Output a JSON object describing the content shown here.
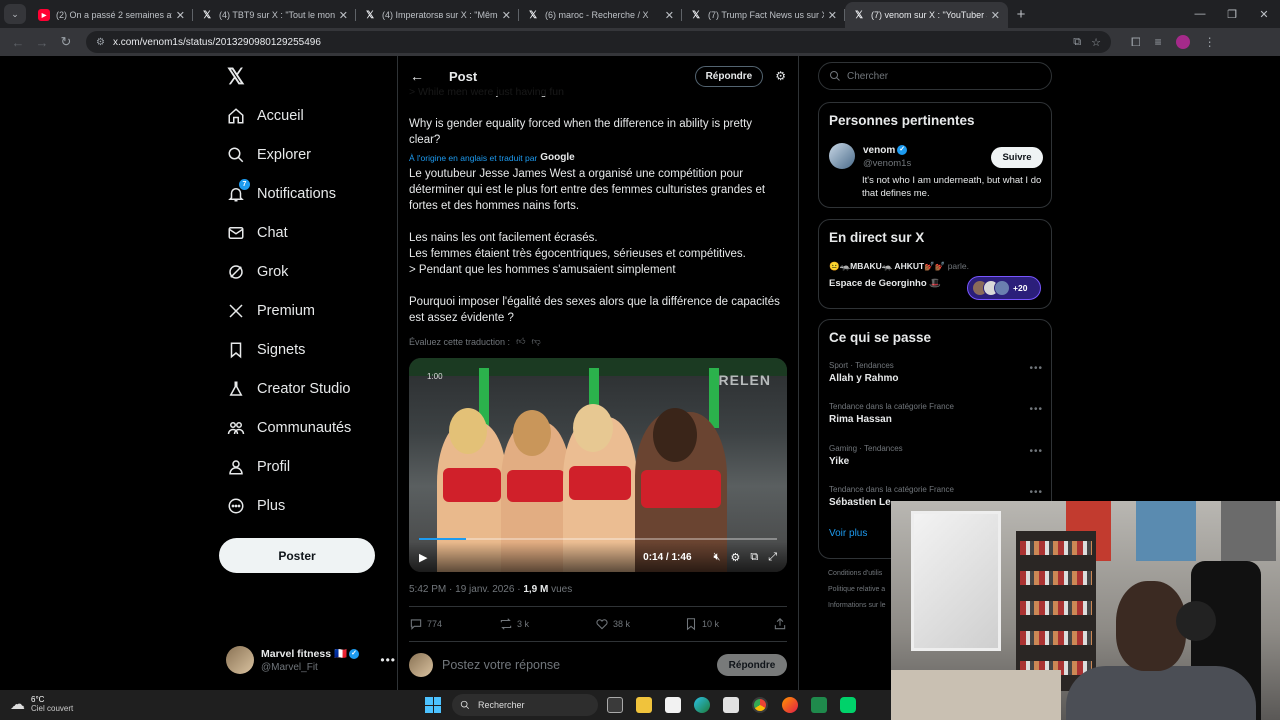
{
  "browser": {
    "tabs": [
      {
        "title": "(2) On a passé 2 semaines avec",
        "icon": "youtube-icon",
        "active": false
      },
      {
        "title": "(4) TBT9 sur X : \"Tout le monde",
        "icon": "x-icon",
        "active": false
      },
      {
        "title": "(4) Imperatorsв sur X : \"Même",
        "icon": "x-icon",
        "active": false
      },
      {
        "title": "(6) maroc - Recherche / X",
        "icon": "x-icon",
        "active": false
      },
      {
        "title": "(7) Trump Fact News us sur X : \"",
        "icon": "x-icon",
        "active": false
      },
      {
        "title": "(7) venom sur X : \"YouTuber Je",
        "icon": "x-icon",
        "active": true
      }
    ],
    "url": "x.com/venom1s/status/2013290980129255496"
  },
  "leftnav": {
    "items": [
      {
        "label": "Accueil",
        "icon": "home-icon"
      },
      {
        "label": "Explorer",
        "icon": "search-icon"
      },
      {
        "label": "Notifications",
        "icon": "bell-icon",
        "badge": "7"
      },
      {
        "label": "Chat",
        "icon": "mail-icon"
      },
      {
        "label": "Grok",
        "icon": "grok-icon"
      },
      {
        "label": "Premium",
        "icon": "x-logo-icon"
      },
      {
        "label": "Signets",
        "icon": "bookmark-icon"
      },
      {
        "label": "Creator Studio",
        "icon": "flask-icon"
      },
      {
        "label": "Communautés",
        "icon": "people-icon"
      },
      {
        "label": "Profil",
        "icon": "user-icon"
      },
      {
        "label": "Plus",
        "icon": "more-circle-icon"
      }
    ],
    "post_button": "Poster",
    "account": {
      "name": "Marvel fitness",
      "flag": "🇫🇷",
      "handle": "@Marvel_Fit"
    }
  },
  "main": {
    "header_title": "Post",
    "reply_button": "Répondre",
    "partial_line": "> While men were just having fun",
    "original_text": "Why is gender equality forced when the difference in ability is pretty clear?",
    "translated_label": "À l'origine en anglais et traduit par",
    "translated_by": "Google",
    "paragraph1": "Le youtubeur Jesse James West a organisé une compétition pour déterminer qui est le plus fort entre des femmes culturistes grandes et fortes et des hommes nains forts.",
    "paragraph2_l1": "Les nains les ont facilement écrasés.",
    "paragraph2_l2": "Les femmes étaient très égocentriques, sérieuses et compétitives.",
    "paragraph2_l3": "> Pendant que les hommes s'amusaient simplement",
    "paragraph3": "Pourquoi imposer l'égalité des sexes alors que la différence de capacités est assez évidente ?",
    "rate_label": "Évaluez cette traduction :",
    "video": {
      "time": "0:14 / 1:46",
      "progress": 0.13,
      "brand_text": "RELEN",
      "corner_time": "1:00"
    },
    "meta": {
      "time": "5:42 PM · 19 janv. 2026 · ",
      "views": "1,9 M",
      "views_label": " vues"
    },
    "stats": {
      "replies": "774",
      "reposts": "3 k",
      "likes": "38 k",
      "bookmarks": "10 k"
    },
    "reply_placeholder": "Postez votre réponse",
    "reply_submit": "Répondre"
  },
  "right": {
    "search_placeholder": "Chercher",
    "relevant": {
      "title": "Personnes pertinentes",
      "name": "venom",
      "handle": "@venom1s",
      "bio": "It's not who I am underneath, but what I do that defines me.",
      "follow": "Suivre"
    },
    "live": {
      "title": "En direct sur X",
      "hosts": "😐🦡MBAKU🦡 AHKUT💅🏾💅🏾",
      "speaking": " parle.",
      "space_name": "Espace de Georginho 🎩",
      "count": "+20"
    },
    "trends": {
      "title": "Ce qui se passe",
      "items": [
        {
          "category": "Sport · Tendances",
          "name": "Allah y Rahmo"
        },
        {
          "category": "Tendance dans la catégorie France",
          "name": "Rima Hassan"
        },
        {
          "category": "Gaming · Tendances",
          "name": "Yike"
        },
        {
          "category": "Tendance dans la catégorie France",
          "name": "Sébastien Le"
        }
      ],
      "see_all": "Voir plus"
    },
    "footer": [
      "Conditions d'utilis",
      "Politique relative a",
      "Informations sur le"
    ]
  },
  "taskbar": {
    "temp": "6°C",
    "weather": "Ciel couvert",
    "search": "Rechercher"
  }
}
